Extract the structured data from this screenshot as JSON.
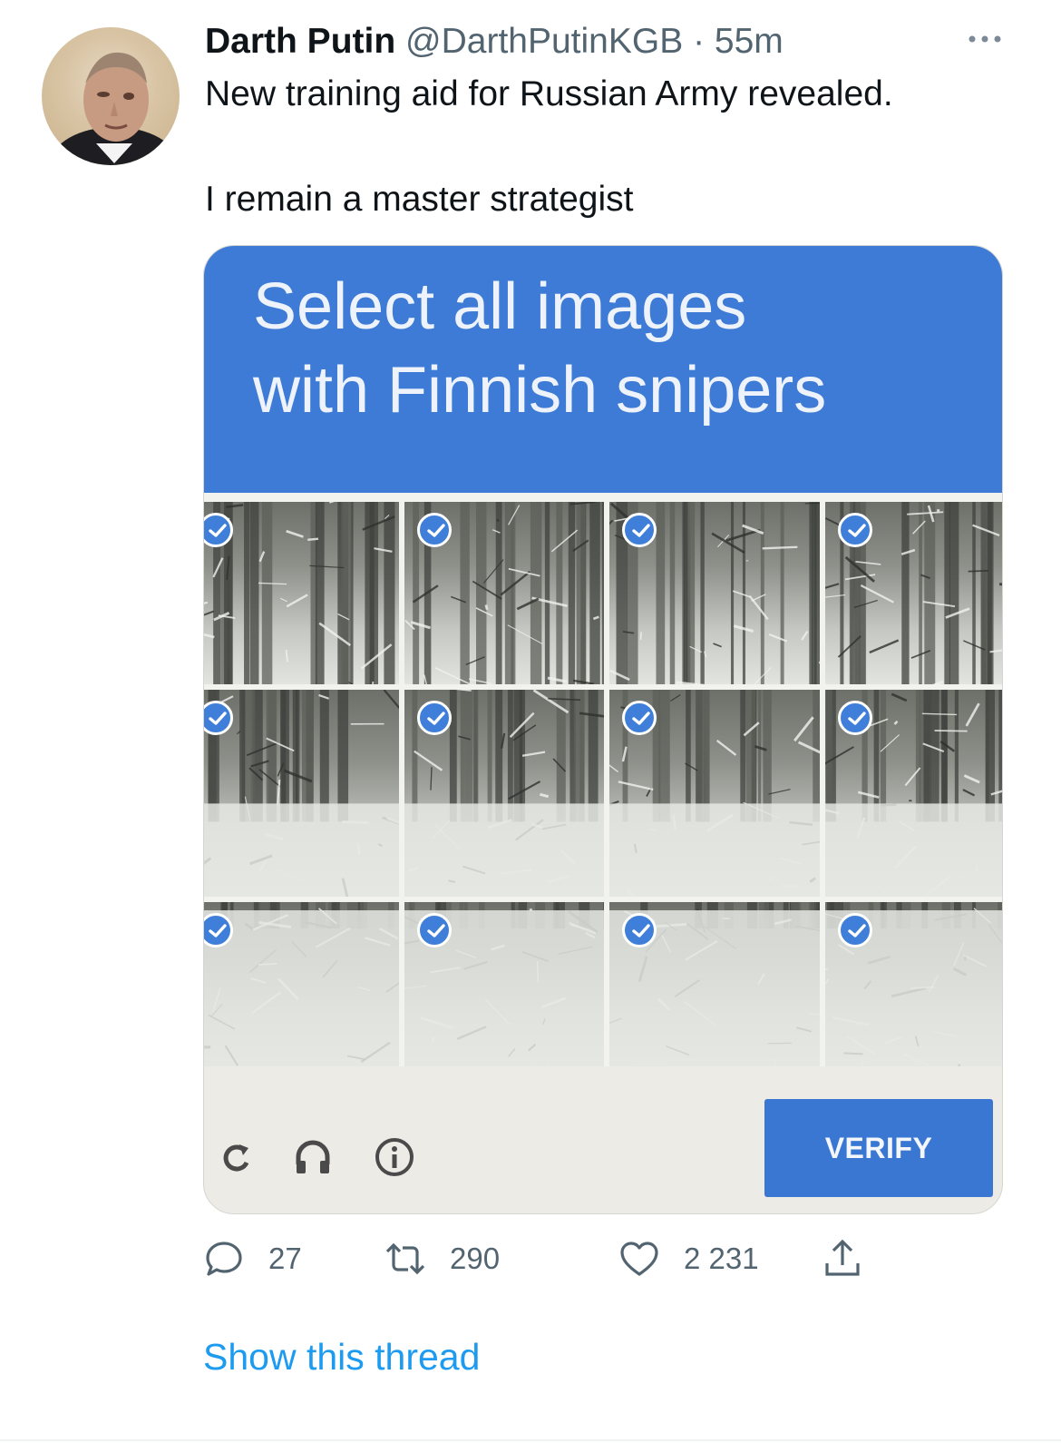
{
  "author": {
    "name": "Darth Putin",
    "handle": "@DarthPutinKGB",
    "separator": "·",
    "time": "55m"
  },
  "tweet": {
    "line1": "New training aid for Russian Army revealed.",
    "line2": "I remain a master strategist"
  },
  "media": {
    "prompt_line1": "Select all images",
    "prompt_line2": "with Finnish snipers",
    "selected_tiles": 12,
    "verify_label": "VERIFY",
    "controls": [
      "reload-icon",
      "headphones-icon",
      "info-icon"
    ]
  },
  "actions": {
    "replies": "27",
    "retweets": "290",
    "likes": "2 231"
  },
  "show_thread": "Show this thread",
  "colors": {
    "captcha_blue": "#3d7bd6",
    "link_blue": "#1d9bf0",
    "muted_gray": "#536471"
  }
}
